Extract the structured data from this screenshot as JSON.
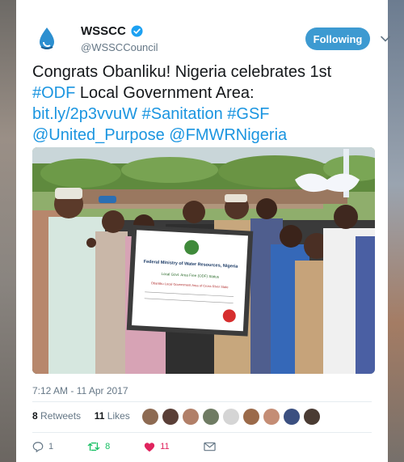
{
  "account": {
    "name": "WSSCC",
    "handle": "@WSSCCouncil",
    "follow_label": "Following"
  },
  "tweet": {
    "line1": "Congrats Obanliku! Nigeria celebrates 1st",
    "hashtag_odf": "#ODF",
    "line2_rest": " Local Government Area:",
    "link": "bit.ly/2p3vvuW",
    "hashtag_sanitation": "#Sanitation",
    "hashtag_gsf": "#GSF",
    "mention_united": "@United_Purpose",
    "mention_fmwr": "@FMWRNigeria"
  },
  "photo": {
    "certificate_title": "Federal Ministry of Water Resources, Nigeria",
    "certificate_line1": "Local Govt. Area Free (ODF) Status",
    "certificate_line2": "Obanliku Local Government Area of Cross River State"
  },
  "meta": {
    "timestamp": "7:12 AM - 11 Apr 2017"
  },
  "stats": {
    "retweets_count": "8",
    "retweets_label": "Retweets",
    "likes_count": "11",
    "likes_label": "Likes"
  },
  "actions": {
    "reply_count": "1",
    "retweet_count": "8",
    "like_count": "11"
  },
  "colors": {
    "accent": "#1b95e0",
    "follow_button": "#3d9ad1",
    "retweet_green": "#17bf63",
    "like_red": "#e0245e"
  }
}
